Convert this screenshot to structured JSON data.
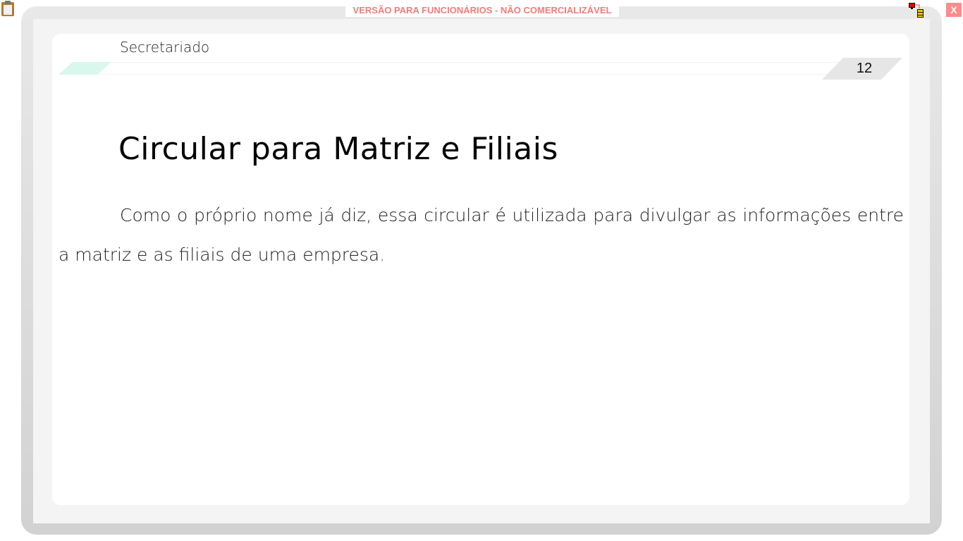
{
  "window": {
    "banner": "VERSÃO PARA FUNCIONÁRIOS - NÃO COMERCIALIZÁVEL",
    "close_label": "X",
    "icons": [
      "clipboard-icon",
      "network-icon"
    ]
  },
  "header": {
    "section": "Secretariado",
    "page_number": "12",
    "accent_color": "#d9f7ec"
  },
  "content": {
    "title": "Circular para Matriz e Filiais",
    "paragraph": "Como o próprio nome já diz, essa circular é utilizada para divulgar as informações entre a matriz e as filiais de uma empresa."
  }
}
